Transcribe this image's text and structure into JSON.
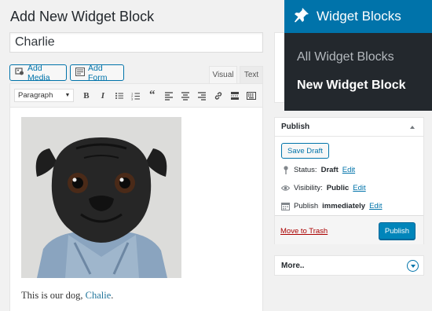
{
  "page": {
    "title": "Add New Widget Block",
    "post_title_value": "Charlie"
  },
  "media_buttons": {
    "add_media": "Add Media",
    "add_form": "Add Form"
  },
  "editor": {
    "tabs": [
      "Visual",
      "Text"
    ],
    "format_select": "Paragraph",
    "caption_prefix": "This is our dog,",
    "caption_link": "Chalie",
    "caption_suffix": ".",
    "image_subject": "black pug in a denim jacket"
  },
  "publish_box": {
    "title": "Publish",
    "save_draft": "Save Draft",
    "status_label": "Status:",
    "status_value": "Draft",
    "visibility_label": "Visibility:",
    "visibility_value": "Public",
    "publish_label": "Publish",
    "publish_value": "immediately",
    "edit_label": "Edit",
    "trash_label": "Move to Trash",
    "publish_button": "Publish"
  },
  "more_box": {
    "title": "More.."
  },
  "flyout": {
    "header": "Widget Blocks",
    "items": [
      "All Widget Blocks",
      "New Widget Block"
    ]
  },
  "colors": {
    "admin_blue": "#0073aa",
    "primary_button": "#0085ba",
    "menu_dark": "#23282d",
    "trash_red": "#a00"
  }
}
